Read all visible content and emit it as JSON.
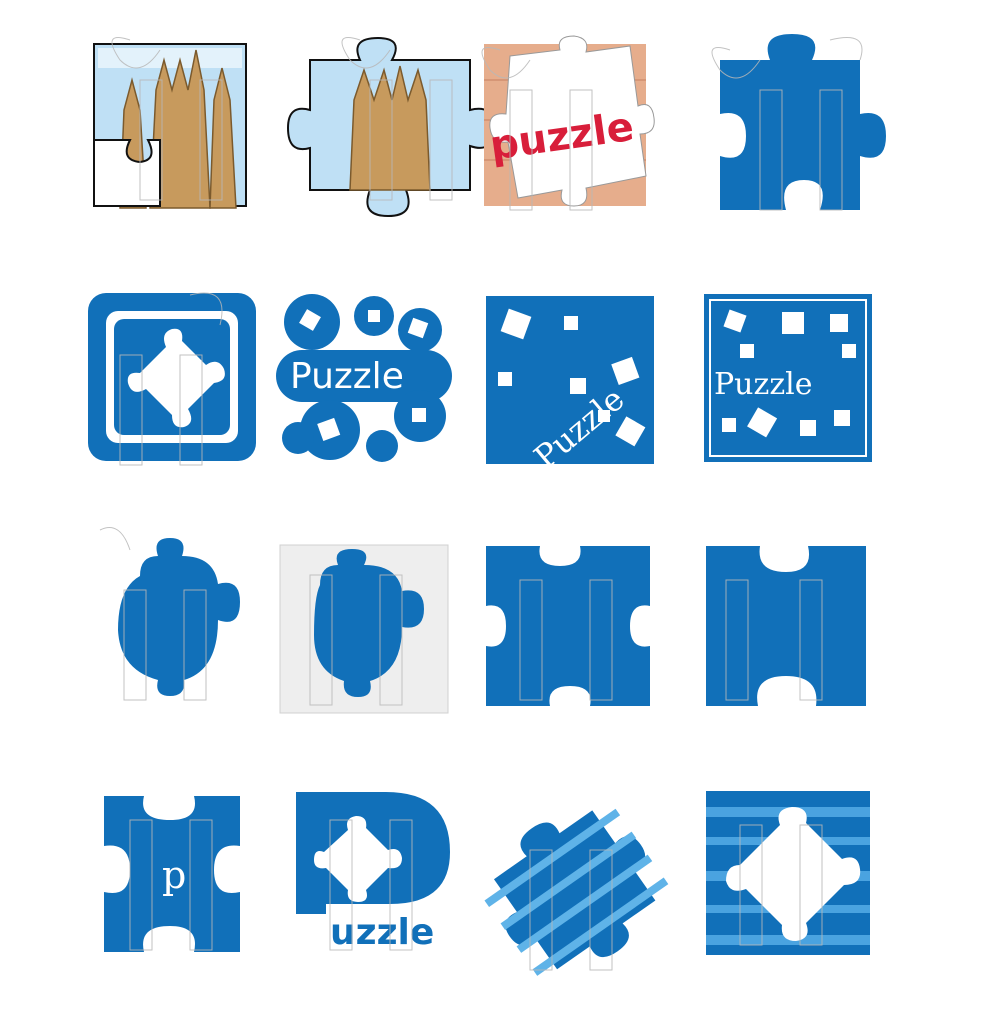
{
  "sheet": {
    "colors": {
      "blue": "#0d64b2",
      "blue_dark": "#0a4f93",
      "blue_light": "#3f8fd2",
      "sky": "#bfe0f5",
      "red": "#d81e3a",
      "wood": "#e6ad8c",
      "stone": "#c79a5d"
    },
    "icons": [
      {
        "name": "jigsaw-photo-square-icon"
      },
      {
        "name": "jigsaw-photo-piece-icon"
      },
      {
        "name": "jigsaw-wood-puzzle-icon",
        "text": "puzzle"
      },
      {
        "name": "jigsaw-blue-piece-icon"
      },
      {
        "name": "jigsaw-rounded-frame-icon"
      },
      {
        "name": "jigsaw-bubbles-icon",
        "text": "Puzzle"
      },
      {
        "name": "jigsaw-diagonal-text-icon",
        "text": "Puzzle"
      },
      {
        "name": "jigsaw-framed-text-icon",
        "text": "Puzzle"
      },
      {
        "name": "jigsaw-blob-piece-icon"
      },
      {
        "name": "jigsaw-inset-piece-icon"
      },
      {
        "name": "jigsaw-cross-cutouts-icon"
      },
      {
        "name": "jigsaw-h-shape-icon"
      },
      {
        "name": "jigsaw-letter-p-icon",
        "text": "p"
      },
      {
        "name": "jigsaw-p-logo-icon",
        "text": "uzzle"
      },
      {
        "name": "jigsaw-tilted-stripes-icon"
      },
      {
        "name": "jigsaw-stripes-square-icon"
      }
    ]
  }
}
